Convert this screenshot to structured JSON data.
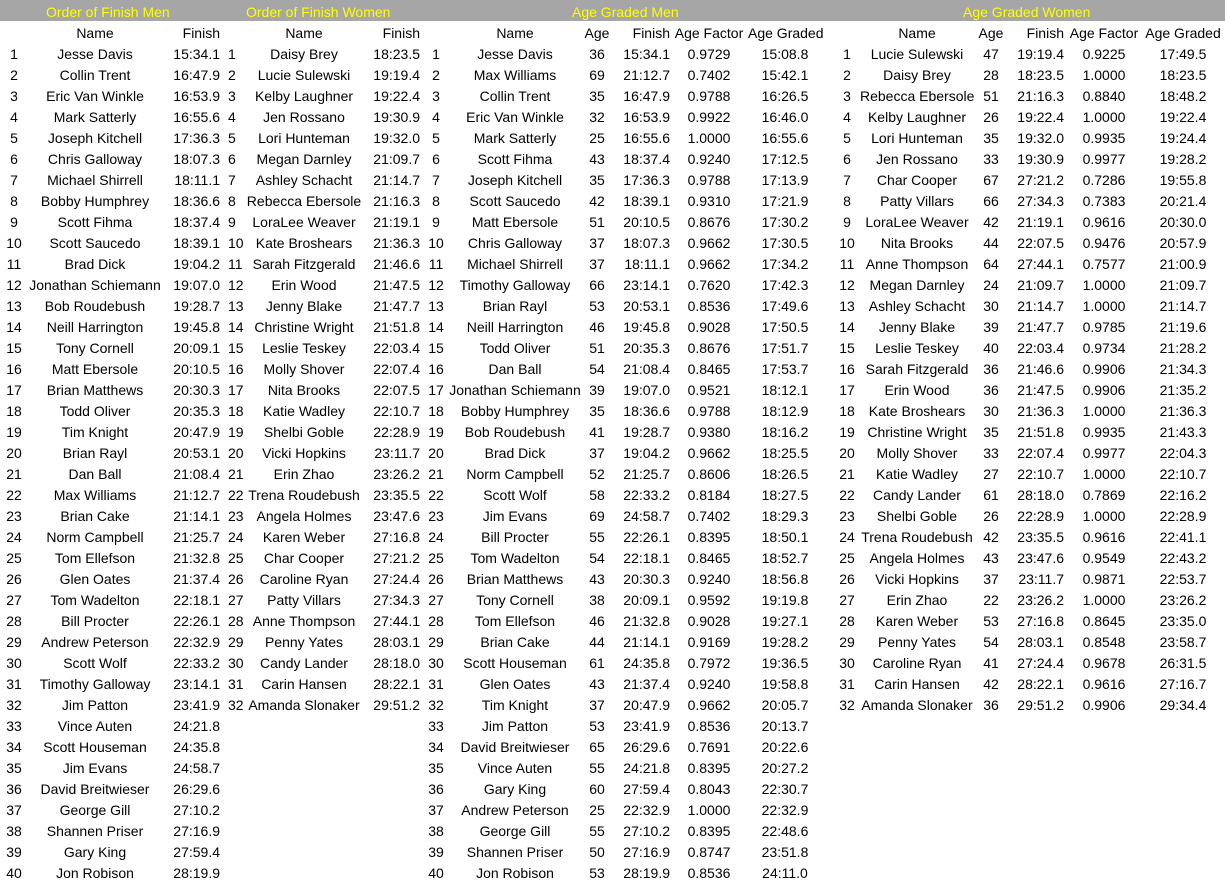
{
  "section_titles": [
    "Order of Finish Men",
    "Order of Finish Women",
    "Age Graded Men",
    "Age Graded Women"
  ],
  "headers": {
    "finish_men": [
      "",
      "Name",
      "Finish"
    ],
    "finish_women": [
      "",
      "Name",
      "Finish"
    ],
    "graded_men": [
      "",
      "Name",
      "Age",
      "Finish",
      "Age Factor",
      "Age Graded"
    ],
    "graded_women": [
      "",
      "Name",
      "Age",
      "Finish",
      "Age Factor",
      "Age Graded"
    ]
  },
  "tables": {
    "finish_men": [
      [
        "1",
        "Jesse Davis",
        "15:34.1"
      ],
      [
        "2",
        "Collin Trent",
        "16:47.9"
      ],
      [
        "3",
        "Eric Van Winkle",
        "16:53.9"
      ],
      [
        "4",
        "Mark Satterly",
        "16:55.6"
      ],
      [
        "5",
        "Joseph Kitchell",
        "17:36.3"
      ],
      [
        "6",
        "Chris Galloway",
        "18:07.3"
      ],
      [
        "7",
        "Michael Shirrell",
        "18:11.1"
      ],
      [
        "8",
        "Bobby Humphrey",
        "18:36.6"
      ],
      [
        "9",
        "Scott Fihma",
        "18:37.4"
      ],
      [
        "10",
        "Scott Saucedo",
        "18:39.1"
      ],
      [
        "11",
        "Brad Dick",
        "19:04.2"
      ],
      [
        "12",
        "Jonathan Schiemann",
        "19:07.0"
      ],
      [
        "13",
        "Bob Roudebush",
        "19:28.7"
      ],
      [
        "14",
        "Neill Harrington",
        "19:45.8"
      ],
      [
        "15",
        "Tony Cornell",
        "20:09.1"
      ],
      [
        "16",
        "Matt Ebersole",
        "20:10.5"
      ],
      [
        "17",
        "Brian Matthews",
        "20:30.3"
      ],
      [
        "18",
        "Todd Oliver",
        "20:35.3"
      ],
      [
        "19",
        "Tim Knight",
        "20:47.9"
      ],
      [
        "20",
        "Brian Rayl",
        "20:53.1"
      ],
      [
        "21",
        "Dan Ball",
        "21:08.4"
      ],
      [
        "22",
        "Max Williams",
        "21:12.7"
      ],
      [
        "23",
        "Brian Cake",
        "21:14.1"
      ],
      [
        "24",
        "Norm Campbell",
        "21:25.7"
      ],
      [
        "25",
        "Tom Ellefson",
        "21:32.8"
      ],
      [
        "26",
        "Glen Oates",
        "21:37.4"
      ],
      [
        "27",
        "Tom Wadelton",
        "22:18.1"
      ],
      [
        "28",
        "Bill Procter",
        "22:26.1"
      ],
      [
        "29",
        "Andrew Peterson",
        "22:32.9"
      ],
      [
        "30",
        "Scott Wolf",
        "22:33.2"
      ],
      [
        "31",
        "Timothy Galloway",
        "23:14.1"
      ],
      [
        "32",
        "Jim Patton",
        "23:41.9"
      ],
      [
        "33",
        "Vince Auten",
        "24:21.8"
      ],
      [
        "34",
        "Scott Houseman",
        "24:35.8"
      ],
      [
        "35",
        "Jim Evans",
        "24:58.7"
      ],
      [
        "36",
        "David Breitwieser",
        "26:29.6"
      ],
      [
        "37",
        "George Gill",
        "27:10.2"
      ],
      [
        "38",
        "Shannen Priser",
        "27:16.9"
      ],
      [
        "39",
        "Gary King",
        "27:59.4"
      ],
      [
        "40",
        "Jon Robison",
        "28:19.9"
      ]
    ],
    "finish_women": [
      [
        "1",
        "Daisy Brey",
        "18:23.5"
      ],
      [
        "2",
        "Lucie Sulewski",
        "19:19.4"
      ],
      [
        "3",
        "Kelby Laughner",
        "19:22.4"
      ],
      [
        "4",
        "Jen Rossano",
        "19:30.9"
      ],
      [
        "5",
        "Lori Hunteman",
        "19:32.0"
      ],
      [
        "6",
        "Megan Darnley",
        "21:09.7"
      ],
      [
        "7",
        "Ashley Schacht",
        "21:14.7"
      ],
      [
        "8",
        "Rebecca Ebersole",
        "21:16.3"
      ],
      [
        "9",
        "LoraLee Weaver",
        "21:19.1"
      ],
      [
        "10",
        "Kate Broshears",
        "21:36.3"
      ],
      [
        "11",
        "Sarah Fitzgerald",
        "21:46.6"
      ],
      [
        "12",
        "Erin Wood",
        "21:47.5"
      ],
      [
        "13",
        "Jenny Blake",
        "21:47.7"
      ],
      [
        "14",
        "Christine Wright",
        "21:51.8"
      ],
      [
        "15",
        "Leslie Teskey",
        "22:03.4"
      ],
      [
        "16",
        "Molly Shover",
        "22:07.4"
      ],
      [
        "17",
        "Nita Brooks",
        "22:07.5"
      ],
      [
        "18",
        "Katie Wadley",
        "22:10.7"
      ],
      [
        "19",
        "Shelbi Goble",
        "22:28.9"
      ],
      [
        "20",
        "Vicki Hopkins",
        "23:11.7"
      ],
      [
        "21",
        "Erin Zhao",
        "23:26.2"
      ],
      [
        "22",
        "Trena Roudebush",
        "23:35.5"
      ],
      [
        "23",
        "Angela Holmes",
        "23:47.6"
      ],
      [
        "24",
        "Karen Weber",
        "27:16.8"
      ],
      [
        "25",
        "Char Cooper",
        "27:21.2"
      ],
      [
        "26",
        "Caroline Ryan",
        "27:24.4"
      ],
      [
        "27",
        "Patty Villars",
        "27:34.3"
      ],
      [
        "28",
        "Anne Thompson",
        "27:44.1"
      ],
      [
        "29",
        "Penny Yates",
        "28:03.1"
      ],
      [
        "30",
        "Candy Lander",
        "28:18.0"
      ],
      [
        "31",
        "Carin Hansen",
        "28:22.1"
      ],
      [
        "32",
        "Amanda Slonaker",
        "29:51.2"
      ]
    ],
    "graded_men": [
      [
        "1",
        "Jesse Davis",
        "36",
        "15:34.1",
        "0.9729",
        "15:08.8"
      ],
      [
        "2",
        "Max Williams",
        "69",
        "21:12.7",
        "0.7402",
        "15:42.1"
      ],
      [
        "3",
        "Collin Trent",
        "35",
        "16:47.9",
        "0.9788",
        "16:26.5"
      ],
      [
        "4",
        "Eric Van Winkle",
        "32",
        "16:53.9",
        "0.9922",
        "16:46.0"
      ],
      [
        "5",
        "Mark Satterly",
        "25",
        "16:55.6",
        "1.0000",
        "16:55.6"
      ],
      [
        "6",
        "Scott Fihma",
        "43",
        "18:37.4",
        "0.9240",
        "17:12.5"
      ],
      [
        "7",
        "Joseph Kitchell",
        "35",
        "17:36.3",
        "0.9788",
        "17:13.9"
      ],
      [
        "8",
        "Scott Saucedo",
        "42",
        "18:39.1",
        "0.9310",
        "17:21.9"
      ],
      [
        "9",
        "Matt Ebersole",
        "51",
        "20:10.5",
        "0.8676",
        "17:30.2"
      ],
      [
        "10",
        "Chris Galloway",
        "37",
        "18:07.3",
        "0.9662",
        "17:30.5"
      ],
      [
        "11",
        "Michael Shirrell",
        "37",
        "18:11.1",
        "0.9662",
        "17:34.2"
      ],
      [
        "12",
        "Timothy Galloway",
        "66",
        "23:14.1",
        "0.7620",
        "17:42.3"
      ],
      [
        "13",
        "Brian Rayl",
        "53",
        "20:53.1",
        "0.8536",
        "17:49.6"
      ],
      [
        "14",
        "Neill Harrington",
        "46",
        "19:45.8",
        "0.9028",
        "17:50.5"
      ],
      [
        "15",
        "Todd Oliver",
        "51",
        "20:35.3",
        "0.8676",
        "17:51.7"
      ],
      [
        "16",
        "Dan Ball",
        "54",
        "21:08.4",
        "0.8465",
        "17:53.7"
      ],
      [
        "17",
        "Jonathan Schiemann",
        "39",
        "19:07.0",
        "0.9521",
        "18:12.1"
      ],
      [
        "18",
        "Bobby Humphrey",
        "35",
        "18:36.6",
        "0.9788",
        "18:12.9"
      ],
      [
        "19",
        "Bob Roudebush",
        "41",
        "19:28.7",
        "0.9380",
        "18:16.2"
      ],
      [
        "20",
        "Brad Dick",
        "37",
        "19:04.2",
        "0.9662",
        "18:25.5"
      ],
      [
        "21",
        "Norm Campbell",
        "52",
        "21:25.7",
        "0.8606",
        "18:26.5"
      ],
      [
        "22",
        "Scott Wolf",
        "58",
        "22:33.2",
        "0.8184",
        "18:27.5"
      ],
      [
        "23",
        "Jim Evans",
        "69",
        "24:58.7",
        "0.7402",
        "18:29.3"
      ],
      [
        "24",
        "Bill Procter",
        "55",
        "22:26.1",
        "0.8395",
        "18:50.1"
      ],
      [
        "25",
        "Tom Wadelton",
        "54",
        "22:18.1",
        "0.8465",
        "18:52.7"
      ],
      [
        "26",
        "Brian Matthews",
        "43",
        "20:30.3",
        "0.9240",
        "18:56.8"
      ],
      [
        "27",
        "Tony Cornell",
        "38",
        "20:09.1",
        "0.9592",
        "19:19.8"
      ],
      [
        "28",
        "Tom Ellefson",
        "46",
        "21:32.8",
        "0.9028",
        "19:27.1"
      ],
      [
        "29",
        "Brian Cake",
        "44",
        "21:14.1",
        "0.9169",
        "19:28.2"
      ],
      [
        "30",
        "Scott Houseman",
        "61",
        "24:35.8",
        "0.7972",
        "19:36.5"
      ],
      [
        "31",
        "Glen Oates",
        "43",
        "21:37.4",
        "0.9240",
        "19:58.8"
      ],
      [
        "32",
        "Tim Knight",
        "37",
        "20:47.9",
        "0.9662",
        "20:05.7"
      ],
      [
        "33",
        "Jim Patton",
        "53",
        "23:41.9",
        "0.8536",
        "20:13.7"
      ],
      [
        "34",
        "David Breitwieser",
        "65",
        "26:29.6",
        "0.7691",
        "20:22.6"
      ],
      [
        "35",
        "Vince Auten",
        "55",
        "24:21.8",
        "0.8395",
        "20:27.2"
      ],
      [
        "36",
        "Gary King",
        "60",
        "27:59.4",
        "0.8043",
        "22:30.7"
      ],
      [
        "37",
        "Andrew Peterson",
        "25",
        "22:32.9",
        "1.0000",
        "22:32.9"
      ],
      [
        "38",
        "George Gill",
        "55",
        "27:10.2",
        "0.8395",
        "22:48.6"
      ],
      [
        "39",
        "Shannen Priser",
        "50",
        "27:16.9",
        "0.8747",
        "23:51.8"
      ],
      [
        "40",
        "Jon Robison",
        "53",
        "28:19.9",
        "0.8536",
        "24:11.0"
      ]
    ],
    "graded_women": [
      [
        "1",
        "Lucie Sulewski",
        "47",
        "19:19.4",
        "0.9225",
        "17:49.5"
      ],
      [
        "2",
        "Daisy Brey",
        "28",
        "18:23.5",
        "1.0000",
        "18:23.5"
      ],
      [
        "3",
        "Rebecca Ebersole",
        "51",
        "21:16.3",
        "0.8840",
        "18:48.2"
      ],
      [
        "4",
        "Kelby Laughner",
        "26",
        "19:22.4",
        "1.0000",
        "19:22.4"
      ],
      [
        "5",
        "Lori Hunteman",
        "35",
        "19:32.0",
        "0.9935",
        "19:24.4"
      ],
      [
        "6",
        "Jen Rossano",
        "33",
        "19:30.9",
        "0.9977",
        "19:28.2"
      ],
      [
        "7",
        "Char Cooper",
        "67",
        "27:21.2",
        "0.7286",
        "19:55.8"
      ],
      [
        "8",
        "Patty Villars",
        "66",
        "27:34.3",
        "0.7383",
        "20:21.4"
      ],
      [
        "9",
        "LoraLee Weaver",
        "42",
        "21:19.1",
        "0.9616",
        "20:30.0"
      ],
      [
        "10",
        "Nita Brooks",
        "44",
        "22:07.5",
        "0.9476",
        "20:57.9"
      ],
      [
        "11",
        "Anne Thompson",
        "64",
        "27:44.1",
        "0.7577",
        "21:00.9"
      ],
      [
        "12",
        "Megan Darnley",
        "24",
        "21:09.7",
        "1.0000",
        "21:09.7"
      ],
      [
        "13",
        "Ashley Schacht",
        "30",
        "21:14.7",
        "1.0000",
        "21:14.7"
      ],
      [
        "14",
        "Jenny Blake",
        "39",
        "21:47.7",
        "0.9785",
        "21:19.6"
      ],
      [
        "15",
        "Leslie Teskey",
        "40",
        "22:03.4",
        "0.9734",
        "21:28.2"
      ],
      [
        "16",
        "Sarah Fitzgerald",
        "36",
        "21:46.6",
        "0.9906",
        "21:34.3"
      ],
      [
        "17",
        "Erin Wood",
        "36",
        "21:47.5",
        "0.9906",
        "21:35.2"
      ],
      [
        "18",
        "Kate Broshears",
        "30",
        "21:36.3",
        "1.0000",
        "21:36.3"
      ],
      [
        "19",
        "Christine Wright",
        "35",
        "21:51.8",
        "0.9935",
        "21:43.3"
      ],
      [
        "20",
        "Molly Shover",
        "33",
        "22:07.4",
        "0.9977",
        "22:04.3"
      ],
      [
        "21",
        "Katie Wadley",
        "27",
        "22:10.7",
        "1.0000",
        "22:10.7"
      ],
      [
        "22",
        "Candy Lander",
        "61",
        "28:18.0",
        "0.7869",
        "22:16.2"
      ],
      [
        "23",
        "Shelbi Goble",
        "26",
        "22:28.9",
        "1.0000",
        "22:28.9"
      ],
      [
        "24",
        "Trena Roudebush",
        "42",
        "23:35.5",
        "0.9616",
        "22:41.1"
      ],
      [
        "25",
        "Angela Holmes",
        "43",
        "23:47.6",
        "0.9549",
        "22:43.2"
      ],
      [
        "26",
        "Vicki Hopkins",
        "37",
        "23:11.7",
        "0.9871",
        "22:53.7"
      ],
      [
        "27",
        "Erin Zhao",
        "22",
        "23:26.2",
        "1.0000",
        "23:26.2"
      ],
      [
        "28",
        "Karen Weber",
        "53",
        "27:16.8",
        "0.8645",
        "23:35.0"
      ],
      [
        "29",
        "Penny Yates",
        "54",
        "28:03.1",
        "0.8548",
        "23:58.7"
      ],
      [
        "30",
        "Caroline Ryan",
        "41",
        "27:24.4",
        "0.9678",
        "26:31.5"
      ],
      [
        "31",
        "Carin Hansen",
        "42",
        "28:22.1",
        "0.9616",
        "27:16.7"
      ],
      [
        "32",
        "Amanda Slonaker",
        "36",
        "29:51.2",
        "0.9906",
        "29:34.4"
      ]
    ]
  }
}
